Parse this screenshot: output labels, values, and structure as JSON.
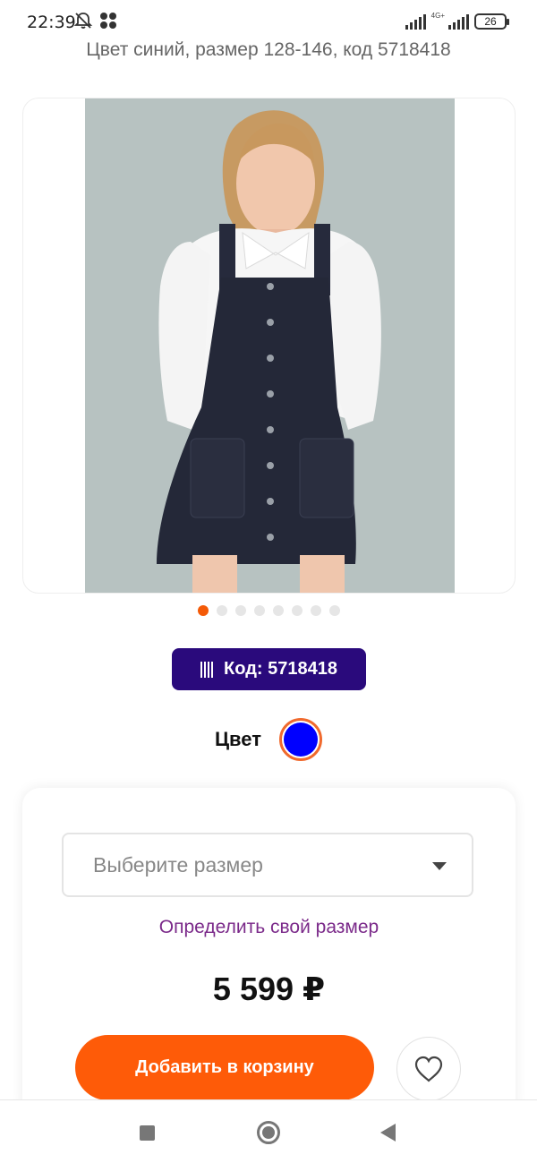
{
  "status_bar": {
    "time": "22:39",
    "network_label": "4G+",
    "battery": "26"
  },
  "product": {
    "title": "Цвет синий, размер 128-146, код 5718418",
    "code_label": "Код: 5718418",
    "color_label": "Цвет",
    "selected_color": "#0000ff",
    "image_count": 8,
    "active_image": 1
  },
  "purchase": {
    "size_placeholder": "Выберите размер",
    "size_link": "Определить свой размер",
    "price": "5 599 ₽",
    "add_to_cart": "Добавить в корзину"
  },
  "colors": {
    "accent": "#fe5b08",
    "badge": "#2a0a7c",
    "link": "#7b2a8a"
  },
  "icons": [
    "bell-off-icon",
    "dots-icon",
    "signal-icon",
    "battery-icon",
    "barcode-icon",
    "chevron-down-icon",
    "heart-icon",
    "nav-recents-icon",
    "nav-home-icon",
    "nav-back-icon"
  ]
}
